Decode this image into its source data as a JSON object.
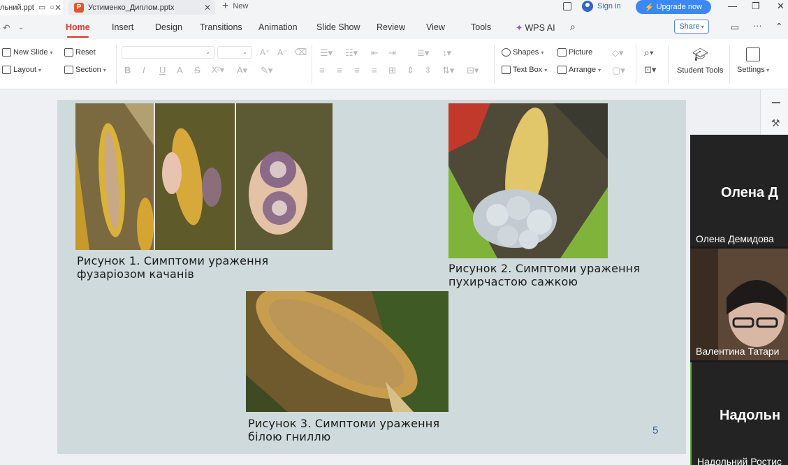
{
  "tabs": [
    {
      "label": "льний.ppt"
    },
    {
      "label": "Устименко_Диплом.pptx"
    }
  ],
  "new_tab_label": "New",
  "titlebar": {
    "sign_in": "Sign in",
    "upgrade": "Upgrade now"
  },
  "menu": {
    "items": [
      "Home",
      "Insert",
      "Design",
      "Transitions",
      "Animation",
      "Slide Show",
      "Review",
      "View",
      "Tools"
    ],
    "active": "Home",
    "wps_ai": "WPS AI",
    "share": "Share"
  },
  "ribbon": {
    "new_slide": "New  Slide",
    "layout": "Layout",
    "reset": "Reset",
    "section": "Section",
    "shapes": "Shapes",
    "picture": "Picture",
    "text_box": "Text Box",
    "arrange": "Arrange",
    "student_tools": "Student Tools",
    "settings": "Settings"
  },
  "slide": {
    "caption1_line1": "Рисунок 1. Симптоми ураження",
    "caption1_line2": "фузаріозом качанів",
    "caption2_line1": "Рисунок 2. Симптоми ураження",
    "caption2_line2": "пухирчастою сажкою",
    "caption3_line1": "Рисунок 3. Симптоми ураження",
    "caption3_line2": "білою гниллю",
    "slide_number": "5"
  },
  "participants": [
    {
      "big_name": "Олена Д",
      "name": "Олена Демидова"
    },
    {
      "name": "Валентина Татари"
    },
    {
      "big_name": "Надольн",
      "name": "Надольний Ростис"
    }
  ],
  "colors": {
    "accent": "#d8372a",
    "upgrade": "#3d86f5",
    "slide_bg": "#cfdadc"
  }
}
